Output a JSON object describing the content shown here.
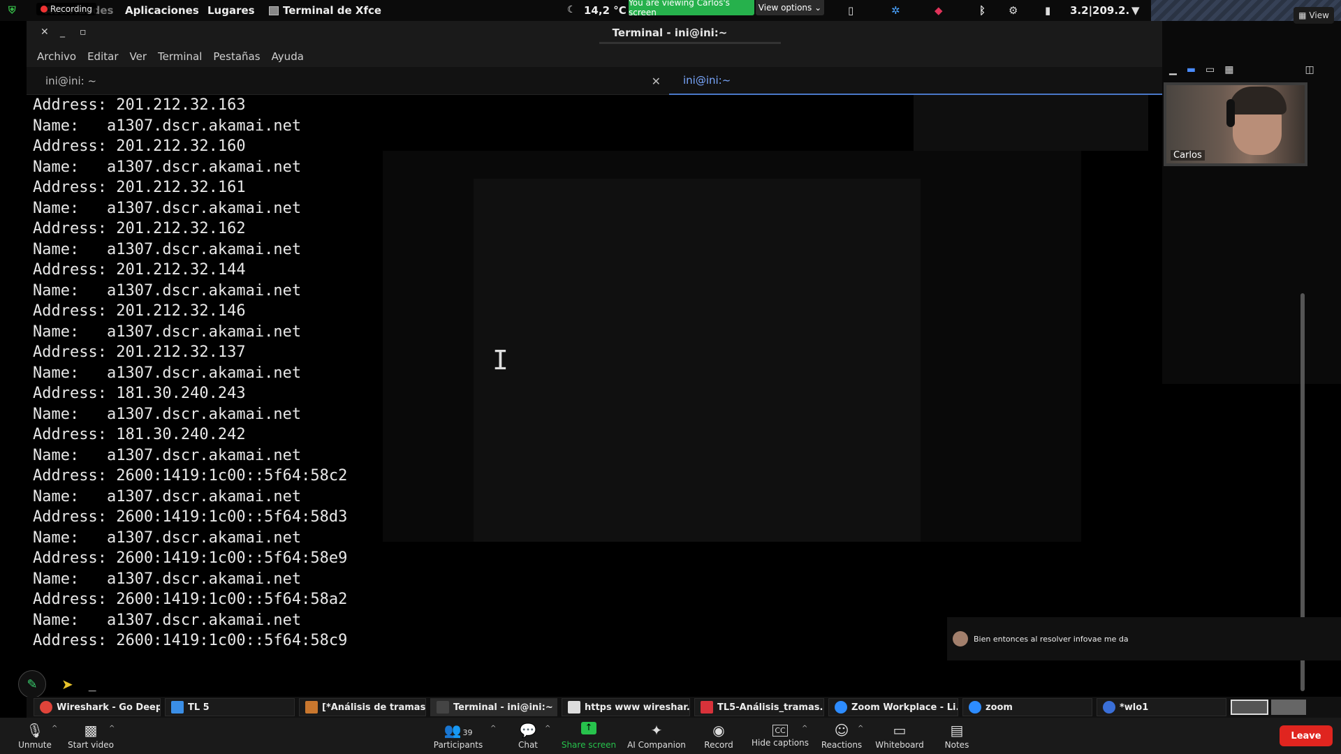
{
  "topbar": {
    "recording": "Recording",
    "activities": "Actividades",
    "applications": "Aplicaciones",
    "places": "Lugares",
    "active_app": "Terminal de Xfce",
    "temperature": "14,2 °C",
    "viewing_banner": "You are viewing Carlos's screen",
    "view_options": "View options",
    "network": "3.2|209.2.",
    "view_button": "View"
  },
  "window": {
    "title": "Terminal - ini@ini:~",
    "menu": [
      "Archivo",
      "Editar",
      "Ver",
      "Terminal",
      "Pestañas",
      "Ayuda"
    ],
    "tabs": [
      {
        "label": "ini@ini: ~",
        "active": false
      },
      {
        "label": "ini@ini:~",
        "active": true
      }
    ]
  },
  "terminal": {
    "lines": [
      "Address: 201.212.32.163",
      "Name:   a1307.dscr.akamai.net",
      "Address: 201.212.32.160",
      "Name:   a1307.dscr.akamai.net",
      "Address: 201.212.32.161",
      "Name:   a1307.dscr.akamai.net",
      "Address: 201.212.32.162",
      "Name:   a1307.dscr.akamai.net",
      "Address: 201.212.32.144",
      "Name:   a1307.dscr.akamai.net",
      "Address: 201.212.32.146",
      "Name:   a1307.dscr.akamai.net",
      "Address: 201.212.32.137",
      "Name:   a1307.dscr.akamai.net",
      "Address: 181.30.240.243",
      "Name:   a1307.dscr.akamai.net",
      "Address: 181.30.240.242",
      "Name:   a1307.dscr.akamai.net",
      "Address: 2600:1419:1c00::5f64:58c2",
      "Name:   a1307.dscr.akamai.net",
      "Address: 2600:1419:1c00::5f64:58d3",
      "Name:   a1307.dscr.akamai.net",
      "Address: 2600:1419:1c00::5f64:58e9",
      "Name:   a1307.dscr.akamai.net",
      "Address: 2600:1419:1c00::5f64:58a2",
      "Name:   a1307.dscr.akamai.net",
      "Address: 2600:1419:1c00::5f64:58c9"
    ],
    "cursor": "_"
  },
  "video": {
    "participant_name": "Carlos"
  },
  "chat_toast": {
    "message": "Bien entonces al resolver infovae me da"
  },
  "taskbar": [
    {
      "label": "Wireshark - Go Deep ...",
      "color": "#e0443a"
    },
    {
      "label": "TL 5",
      "color": "#3a8ee6"
    },
    {
      "label": "[*Análisis de tramas ...",
      "color": "#c9772e"
    },
    {
      "label": "Terminal - ini@ini:~",
      "color": "#444444"
    },
    {
      "label": "https www wireshar...",
      "color": "#dddddd"
    },
    {
      "label": "TL5-Análisis_tramas...",
      "color": "#d8323a"
    },
    {
      "label": "Zoom Workplace - Li...",
      "color": "#2d8cff"
    },
    {
      "label": "zoom",
      "color": "#2d8cff"
    },
    {
      "label": "*wlo1",
      "color": "#3a6fd8"
    }
  ],
  "zoom_controls": {
    "unmute": "Unmute",
    "start_video": "Start video",
    "participants": "Participants",
    "participant_count": "39",
    "chat": "Chat",
    "share_screen": "Share screen",
    "ai_companion": "AI Companion",
    "record": "Record",
    "hide_captions": "Hide captions",
    "captions_icon_text": "CC",
    "reactions": "Reactions",
    "whiteboard": "Whiteboard",
    "notes": "Notes",
    "leave": "Leave"
  },
  "colors": {
    "share_green": "#27c24c",
    "leave_red": "#e0251f",
    "active_tab_blue": "#7aa8ff"
  }
}
